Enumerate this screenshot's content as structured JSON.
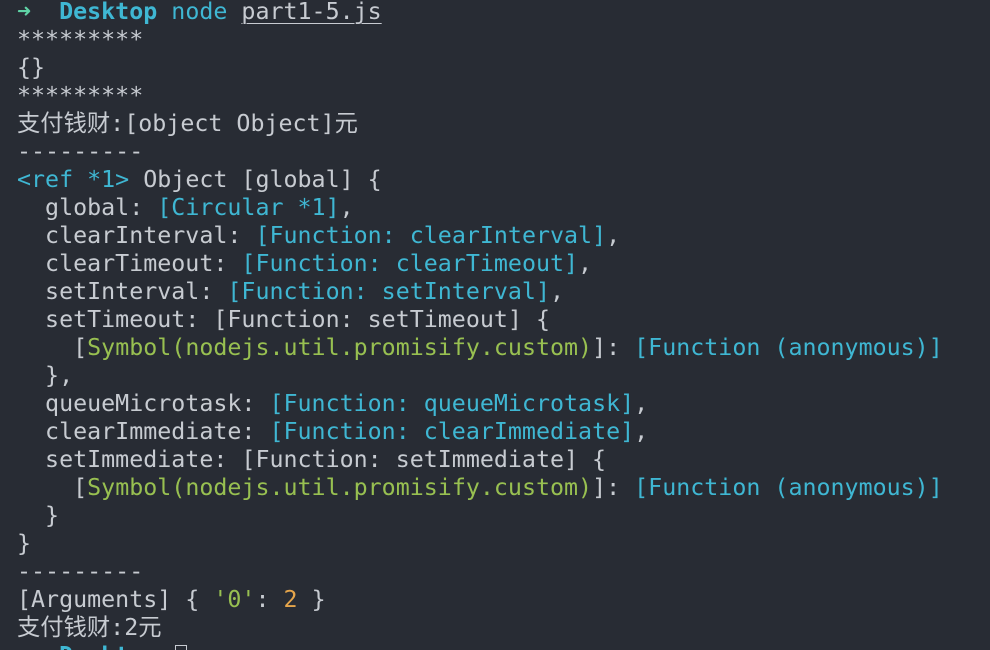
{
  "colors": {
    "background": "#282c34",
    "text": "#c7cbd1",
    "prompt_arrow": "#5fd3a6",
    "cyan": "#3fb7d3",
    "green": "#98c051",
    "orange": "#e5a54b"
  },
  "lines": [
    [
      {
        "text": "➜  ",
        "color": "prompt_arrow",
        "bold": true
      },
      {
        "text": "Desktop",
        "color": "cyan",
        "bold": true
      },
      {
        "text": " node ",
        "color": "cyan"
      },
      {
        "text": "part1-5.js",
        "color": "text",
        "underline": true
      }
    ],
    [
      {
        "text": "*********",
        "color": "text"
      }
    ],
    [
      {
        "text": "{}",
        "color": "text"
      }
    ],
    [
      {
        "text": "*********",
        "color": "text"
      }
    ],
    [
      {
        "text": "支付钱财:[object Object]元",
        "color": "text"
      }
    ],
    [
      {
        "text": "---------",
        "color": "text"
      }
    ],
    [
      {
        "text": "<ref *1>",
        "color": "cyan"
      },
      {
        "text": " Object [global] {",
        "color": "text"
      }
    ],
    [
      {
        "text": "  global: ",
        "color": "text"
      },
      {
        "text": "[Circular *1]",
        "color": "cyan"
      },
      {
        "text": ",",
        "color": "text"
      }
    ],
    [
      {
        "text": "  clearInterval: ",
        "color": "text"
      },
      {
        "text": "[Function: clearInterval]",
        "color": "cyan"
      },
      {
        "text": ",",
        "color": "text"
      }
    ],
    [
      {
        "text": "  clearTimeout: ",
        "color": "text"
      },
      {
        "text": "[Function: clearTimeout]",
        "color": "cyan"
      },
      {
        "text": ",",
        "color": "text"
      }
    ],
    [
      {
        "text": "  setInterval: ",
        "color": "text"
      },
      {
        "text": "[Function: setInterval]",
        "color": "cyan"
      },
      {
        "text": ",",
        "color": "text"
      }
    ],
    [
      {
        "text": "  setTimeout: [Function: setTimeout] {",
        "color": "text"
      }
    ],
    [
      {
        "text": "    [",
        "color": "text"
      },
      {
        "text": "Symbol(nodejs.util.promisify.custom)",
        "color": "green"
      },
      {
        "text": "]: ",
        "color": "text"
      },
      {
        "text": "[Function (anonymous)]",
        "color": "cyan"
      }
    ],
    [
      {
        "text": "  },",
        "color": "text"
      }
    ],
    [
      {
        "text": "  queueMicrotask: ",
        "color": "text"
      },
      {
        "text": "[Function: queueMicrotask]",
        "color": "cyan"
      },
      {
        "text": ",",
        "color": "text"
      }
    ],
    [
      {
        "text": "  clearImmediate: ",
        "color": "text"
      },
      {
        "text": "[Function: clearImmediate]",
        "color": "cyan"
      },
      {
        "text": ",",
        "color": "text"
      }
    ],
    [
      {
        "text": "  setImmediate: [Function: setImmediate] {",
        "color": "text"
      }
    ],
    [
      {
        "text": "    [",
        "color": "text"
      },
      {
        "text": "Symbol(nodejs.util.promisify.custom)",
        "color": "green"
      },
      {
        "text": "]: ",
        "color": "text"
      },
      {
        "text": "[Function (anonymous)]",
        "color": "cyan"
      }
    ],
    [
      {
        "text": "  }",
        "color": "text"
      }
    ],
    [
      {
        "text": "}",
        "color": "text"
      }
    ],
    [
      {
        "text": "---------",
        "color": "text"
      }
    ],
    [
      {
        "text": "[Arguments] { ",
        "color": "text"
      },
      {
        "text": "'0'",
        "color": "green"
      },
      {
        "text": ": ",
        "color": "text"
      },
      {
        "text": "2",
        "color": "orange"
      },
      {
        "text": " }",
        "color": "text"
      }
    ],
    [
      {
        "text": "支付钱财:2元",
        "color": "text"
      }
    ],
    [
      {
        "text": "➜  ",
        "color": "prompt_arrow",
        "bold": true
      },
      {
        "text": "Desktop",
        "color": "cyan",
        "bold": true
      },
      {
        "text": " ",
        "color": "text"
      }
    ]
  ],
  "cursor": {
    "shape": "hollow-block-cursor"
  }
}
